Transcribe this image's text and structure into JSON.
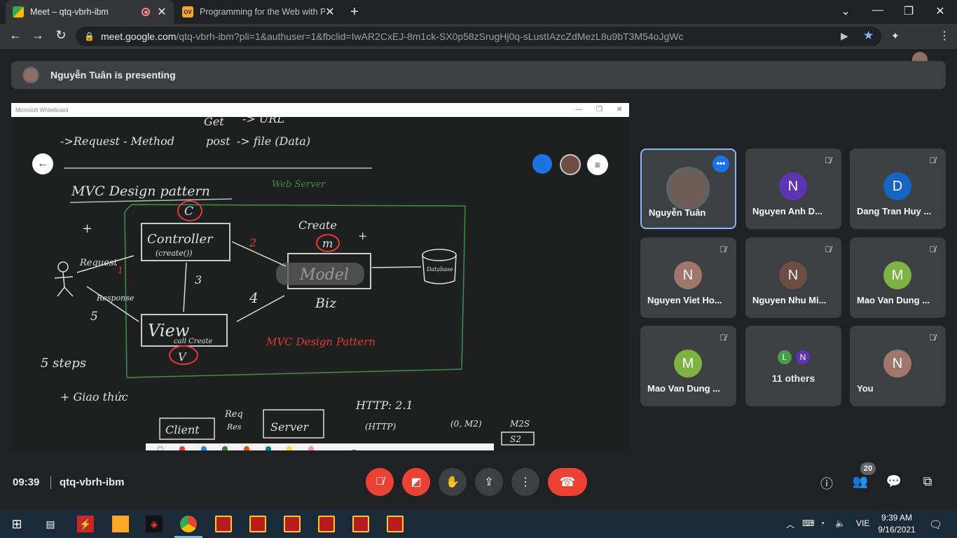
{
  "browser": {
    "tabs": [
      {
        "title": "Meet – qtq-vbrh-ibm",
        "active": true,
        "recording": true
      },
      {
        "title": "Programming for the Web with P",
        "active": false
      }
    ],
    "favicon_ov": "OV",
    "url_host": "meet.google.com",
    "url_path": "/qtq-vbrh-ibm?pli=1&authuser=1&fbclid=IwAR2CxEJ-8m1ck-SX0p58zSrugHj0q-sLustIAzcZdMezL8u9bT3M54oJgWc"
  },
  "meet": {
    "presenting_text": "Nguyễn Tuân is presenting",
    "whiteboard_title": "Microsoft Whiteboard",
    "meeting_time": "09:39",
    "meeting_code": "qtq-vbrh-ibm",
    "people_count": "20"
  },
  "whiteboard": {
    "lines": {
      "request_method": "->Request - Method",
      "get": "Get",
      "url": "-> URL",
      "post": "post",
      "file": "-> file (Data)",
      "mvc_title": "MVC Design pattern",
      "web_server": "Web Server",
      "c": "C",
      "controller": "Controller",
      "controller_sub": "(create())",
      "create": "Create",
      "m": "m",
      "model": "Model",
      "biz": "Biz",
      "database": "Database",
      "request": "Request",
      "response": "Response",
      "view": "View",
      "view_sub": "call Create",
      "v": "V",
      "mvc_red": "MVC Design Pattern",
      "steps": "5 steps",
      "giao_thuc": "+ Giao thức",
      "client": "Client",
      "server": "Server",
      "req": "Req",
      "res": "Res",
      "http": "HTTP: 2.1",
      "n1": "1",
      "n2": "2",
      "n3": "3",
      "n4": "4",
      "n5": "5",
      "plus": "+",
      "m2s": "M2S",
      "s2": "S2",
      "m2": "(0, M2)",
      "http_sub": "(HTTP)"
    }
  },
  "participants": [
    {
      "name": "Nguyễn Tuân",
      "initial": "",
      "color": "#6d5d55",
      "speaking": true,
      "muted": false
    },
    {
      "name": "Nguyen Anh D...",
      "initial": "N",
      "color": "#5e35b1",
      "muted": true
    },
    {
      "name": "Dang Tran Huy ...",
      "initial": "D",
      "color": "#1565c0",
      "muted": true
    },
    {
      "name": "Nguyen Viet Ho...",
      "initial": "N",
      "color": "#a1766a",
      "muted": true
    },
    {
      "name": "Nguyen Nhu Mi...",
      "initial": "N",
      "color": "#6d4c41",
      "muted": true
    },
    {
      "name": "Mao Van Dung ...",
      "initial": "M",
      "color": "#7cb342",
      "muted": true
    },
    {
      "name": "Mao Van Dung ...",
      "initial": "M",
      "color": "#7cb342",
      "muted": true
    },
    {
      "name": "",
      "others_label": "11 others",
      "initials": [
        "L",
        "N"
      ],
      "colors": [
        "#43a047",
        "#5e35b1"
      ]
    },
    {
      "name": "You",
      "initial": "N",
      "color": "#a1766a",
      "muted": true
    }
  ],
  "taskbar": {
    "time": "9:39 AM",
    "date": "9/16/2021",
    "lang": "VIE"
  }
}
